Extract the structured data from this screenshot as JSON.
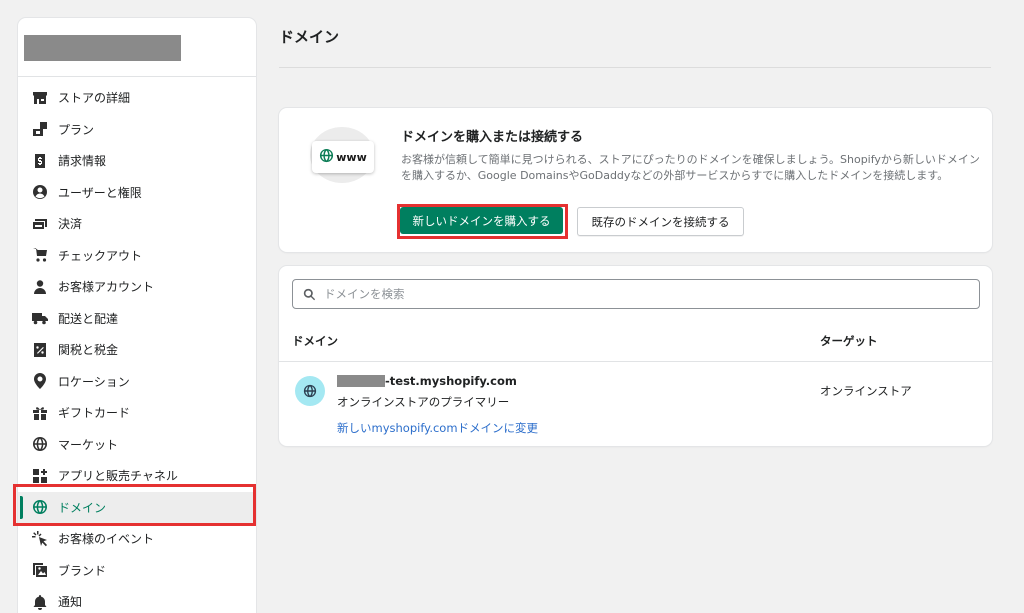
{
  "sidebar": {
    "items": [
      {
        "label": "ストアの詳細",
        "icon": "store-icon"
      },
      {
        "label": "プラン",
        "icon": "plan-icon"
      },
      {
        "label": "請求情報",
        "icon": "billing-icon"
      },
      {
        "label": "ユーザーと権限",
        "icon": "user-circle-icon"
      },
      {
        "label": "決済",
        "icon": "payment-card-icon"
      },
      {
        "label": "チェックアウト",
        "icon": "cart-icon"
      },
      {
        "label": "お客様アカウント",
        "icon": "person-icon"
      },
      {
        "label": "配送と配達",
        "icon": "truck-icon"
      },
      {
        "label": "関税と税金",
        "icon": "tax-icon"
      },
      {
        "label": "ロケーション",
        "icon": "location-pin-icon"
      },
      {
        "label": "ギフトカード",
        "icon": "gift-icon"
      },
      {
        "label": "マーケット",
        "icon": "globe-market-icon"
      },
      {
        "label": "アプリと販売チャネル",
        "icon": "apps-icon"
      },
      {
        "label": "ドメイン",
        "icon": "globe-icon",
        "active": true
      },
      {
        "label": "お客様のイベント",
        "icon": "cursor-click-icon"
      },
      {
        "label": "ブランド",
        "icon": "brand-icon"
      },
      {
        "label": "通知",
        "icon": "bell-icon"
      }
    ]
  },
  "page": {
    "title": "ドメイン"
  },
  "promo": {
    "illustration_text": "www",
    "heading": "ドメインを購入または接続する",
    "description": "お客様が信頼して簡単に見つけられる、ストアにぴったりのドメインを確保しましょう。Shopifyから新しいドメインを購入するか、Google DomainsやGoDaddyなどの外部サービスからすでに購入したドメインを接続します。",
    "buy_button": "新しいドメインを購入する",
    "connect_button": "既存のドメインを接続する"
  },
  "domains": {
    "search_placeholder": "ドメインを検索",
    "columns": {
      "domain": "ドメイン",
      "target": "ターゲット"
    },
    "rows": [
      {
        "name": "-test.myshopify.com",
        "subtitle": "オンラインストアのプライマリー",
        "link": "新しいmyshopify.comドメインに変更",
        "target": "オンラインストア"
      }
    ]
  },
  "colors": {
    "accent": "#007f5f",
    "highlight": "#e53131",
    "link": "#2c6ecb"
  }
}
